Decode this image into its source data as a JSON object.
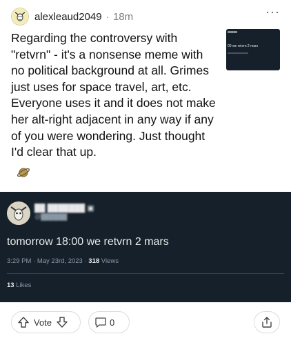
{
  "post": {
    "username": "alexleaud2049",
    "separator": "·",
    "age": "18m",
    "more_label": "···",
    "text": "Regarding the controversy with \"retvrn\" - it's a nonsense meme with no political background at all. Grimes just uses for space travel, art, etc. Everyone uses it and it does not make her alt-right adjacent in any way if any of you were wondering. Just thought I'd clear that up.",
    "thumbnail_text": "00 we retvrn 2 mars"
  },
  "tweet": {
    "text": "tomorrow 18:00 we retvrn 2 mars",
    "time_date": "3:29 PM · May 23rd, 2023 · ",
    "views_count": "318",
    "views_label": " Views",
    "likes_count": "13",
    "likes_label": " Likes"
  },
  "actions": {
    "vote_label": "Vote",
    "comment_count": "0"
  },
  "colors": {
    "tweet_background": "#15202b",
    "tweet_text": "#e7e9ea",
    "tweet_muted": "#8b98a5"
  },
  "icons": {
    "more": "more-options-icon",
    "upvote": "upvote-arrow-icon",
    "downvote": "downvote-arrow-icon",
    "comment": "comment-bubble-icon",
    "share": "share-icon",
    "award": "planet-award-icon"
  }
}
